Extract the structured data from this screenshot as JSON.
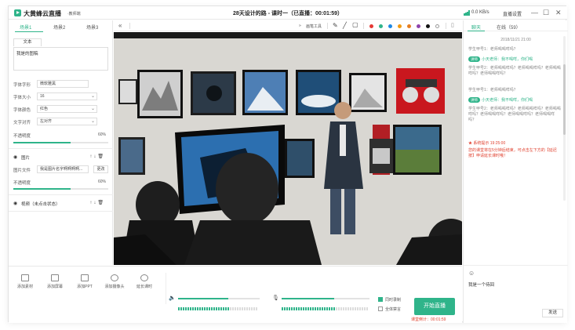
{
  "app": {
    "name": "大黄蜂云直播",
    "version": "·教师端",
    "window_title": "28天设计的路 - 课时一（已直播：00:01:59）",
    "net_speed": "0.0 KB/s",
    "settings_label": "直播设置",
    "minimize_glyph": "—",
    "maximize_glyph": "☐",
    "close_glyph": "✕"
  },
  "scenes": {
    "tabs": [
      "场景1",
      "场景2",
      "场景3"
    ],
    "active_index": 0
  },
  "text_panel": {
    "subtab": "文本",
    "content": "我是的图稿",
    "font_label": "字体字形",
    "font_value": "微软雅黑",
    "size_label": "字体大小",
    "size_value": "16",
    "color_label": "字体颜色",
    "color_value": "红色",
    "align_label": "文字对齐",
    "align_value": "左对齐",
    "opacity_label": "不透明度",
    "opacity_value": "60%",
    "opacity_fraction": 0.6
  },
  "image_panel": {
    "title": "图片",
    "file_label": "图片文件",
    "file_value": "我是图片名字啊啊啊啊...",
    "change_label": "更改",
    "opacity_label": "不透明度",
    "opacity_value": "60%",
    "opacity_fraction": 0.6
  },
  "video_panel": {
    "title": "视频（未点击状态）"
  },
  "toolbar": {
    "collapse_glyph": "«",
    "expand_glyph": "»",
    "draw_tools_label": "画笔工具",
    "colors": [
      "#e53935",
      "#2fb48a",
      "#1e88e5",
      "#f39c12",
      "#e67e22",
      "#8e44ad",
      "#111111",
      "#ffffff"
    ]
  },
  "bottom_tools": [
    {
      "label": "添加素材",
      "icon": "add-material-icon"
    },
    {
      "label": "添加屏幕",
      "icon": "add-screen-icon"
    },
    {
      "label": "添加PPT",
      "icon": "add-ppt-icon"
    },
    {
      "label": "添加摄像头",
      "icon": "add-camera-icon"
    },
    {
      "label": "延长课时",
      "icon": "extend-time-icon"
    }
  ],
  "audio": {
    "speaker_level": 0.62,
    "mic_level": 0.6
  },
  "live_controls": {
    "record_label": "同时录制",
    "record_checked": true,
    "fullscreen_label": "全体禁言",
    "fullscreen_checked": false,
    "start_label": "开始直播",
    "countdown": "课堂倒计：00:01:59"
  },
  "chat": {
    "tabs": [
      "聊天",
      "在线（59）"
    ],
    "active_index": 0,
    "timestamp": "2018/11/21 21:00",
    "messages": [
      {
        "type": "student",
        "text": "学生甲号1：老师喝喝咩吗？"
      },
      {
        "type": "teacher",
        "badge": "讲师",
        "text": "小天老师：我不喝咩，你们喝"
      },
      {
        "type": "student",
        "text": "学生甲号2：老师喝喝咩吗？老师喝喝咩吗？老师喝喝咩吗？老师喝喝咩吗？"
      },
      {
        "type": "student",
        "text": "学生甲号1：老师喝喝咩吗？"
      },
      {
        "type": "teacher",
        "badge": "讲师",
        "text": "小天老师：我不喝咩，你们喝"
      },
      {
        "type": "student",
        "text": "学生甲号2：老师喝喝咩吗？老师喝喝咩吗？老师喝喝咩吗？老师喝喝咩吗？老师喝喝咩吗？老师喝喝咩吗？"
      }
    ],
    "system_title": "★ 系统提示 19:25:00",
    "system_text": "您的课堂将在5分钟后结束，可点击左下方的【延迟按】申请延长课时哦！",
    "draft": "我是一个待回",
    "send_label": "发送"
  }
}
